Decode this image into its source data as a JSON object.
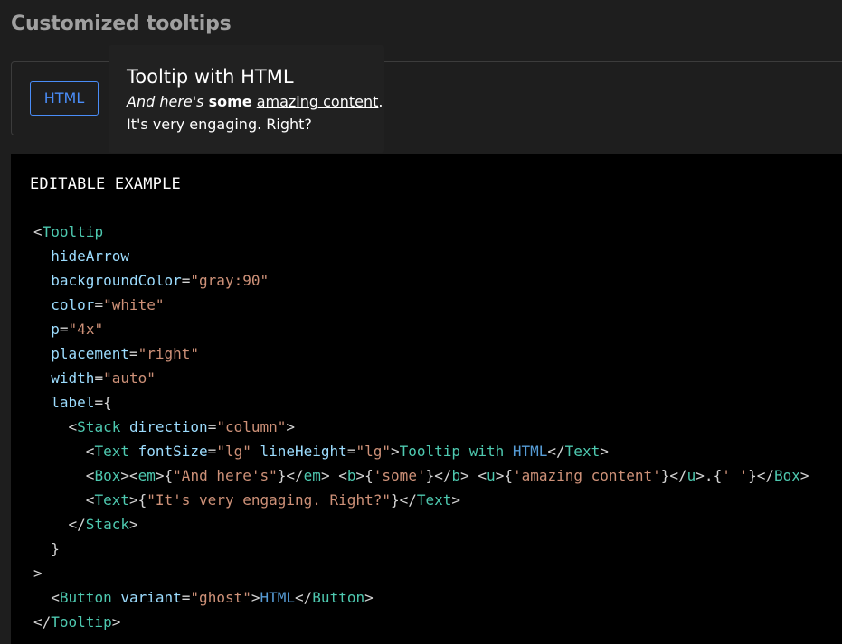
{
  "section": {
    "title": "Customized tooltips"
  },
  "preview": {
    "button_label": "HTML"
  },
  "tooltip": {
    "title": "Tooltip with HTML",
    "italic_text": "And here's",
    "bold_text": "some",
    "underlined_text": "amazing content",
    "after_underline": ".",
    "line2": "It's very engaging. Right?"
  },
  "code_block": {
    "label": "EDITABLE EXAMPLE",
    "lines": [
      "<Tooltip",
      "  hideArrow",
      "  backgroundColor=\"gray:90\"",
      "  color=\"white\"",
      "  p=\"4x\"",
      "  placement=\"right\"",
      "  width=\"auto\"",
      "  label={",
      "    <Stack direction=\"column\">",
      "      <Text fontSize=\"lg\" lineHeight=\"lg\">Tooltip with HTML</Text>",
      "      <Box><em>{\"And here's\"}</em> <b>{'some'}</b> <u>{'amazing content'}</u>.{' '}</Box>",
      "      <Text>{\"It's very engaging. Right?\"}</Text>",
      "    </Stack>",
      "  }",
      ">",
      "  <Button variant=\"ghost\">HTML</Button>",
      "</Tooltip>"
    ]
  },
  "colors": {
    "page_bg": "#1e1e1e",
    "button_accent": "#4a8df8",
    "tooltip_bg": "#212121",
    "code_bg": "#000000",
    "code_tag": "#4ec9b0",
    "code_attr": "#9cdcfe",
    "code_string": "#ce9178",
    "code_keyword": "#569cd6"
  }
}
